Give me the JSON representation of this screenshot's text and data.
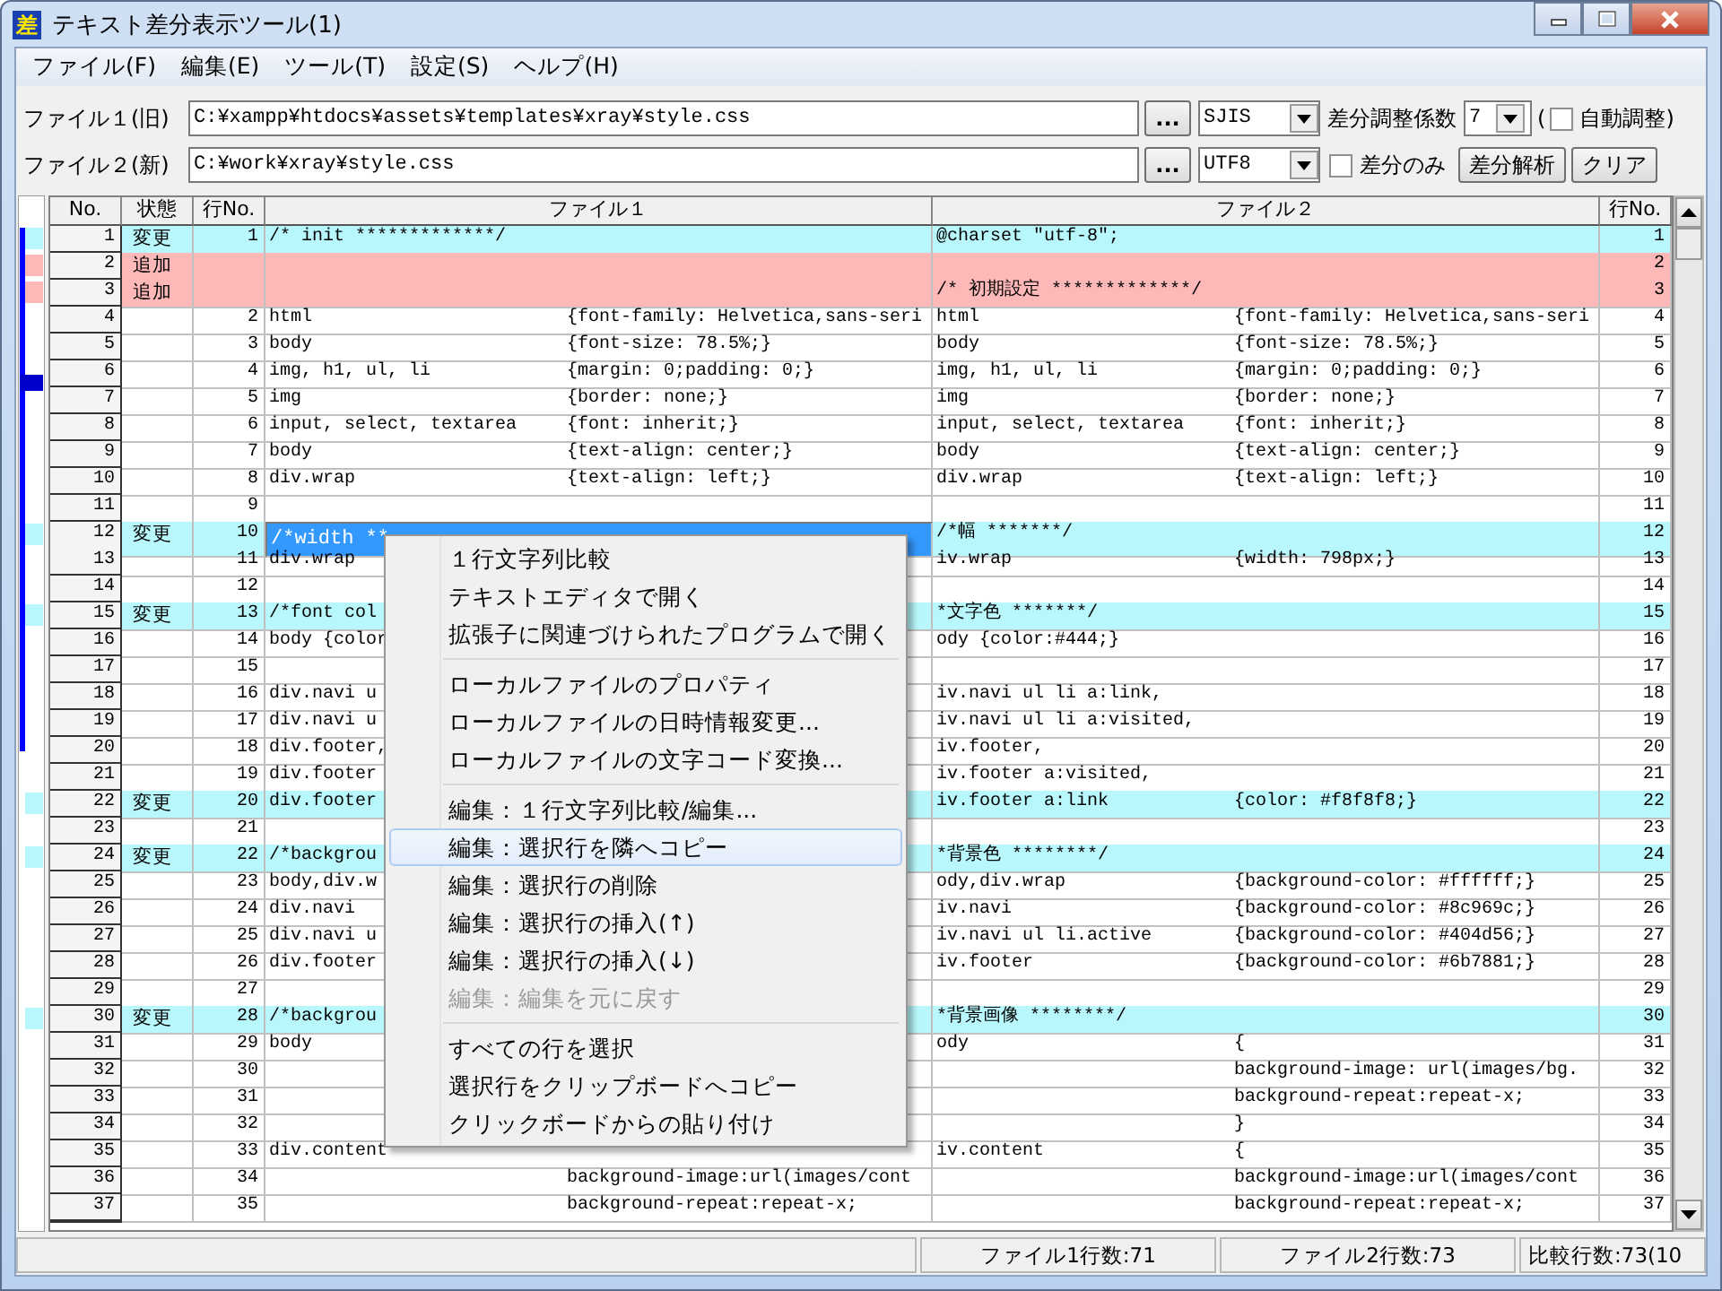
{
  "window": {
    "app_icon": "差",
    "title": "テキスト差分表示ツール(1)"
  },
  "menu_bar": [
    "ファイル(F)",
    "編集(E)",
    "ツール(T)",
    "設定(S)",
    "ヘルプ(H)"
  ],
  "file1": {
    "label": "ファイル１(旧)",
    "path": "C:¥xampp¥htdocs¥assets¥templates¥xray¥style.css",
    "browse": "...",
    "encoding": "SJIS"
  },
  "tuning": {
    "label": "差分調整係数",
    "value": "7",
    "open_paren": "(",
    "auto_label": "自動調整)",
    "auto_checked": false
  },
  "file2": {
    "label": "ファイル２(新)",
    "path": "C:¥work¥xray¥style.css",
    "browse": "...",
    "encoding": "UTF8"
  },
  "diff_only": {
    "label": "差分のみ",
    "checked": false
  },
  "buttons": [
    "差分解析",
    "クリア"
  ],
  "table": {
    "columns": [
      "No.",
      "状態",
      "行No.",
      "ファイル１",
      "ファイル２",
      "行No."
    ],
    "rows": [
      {
        "no": "1",
        "state": "変更",
        "kind": "changed",
        "line1": "1",
        "file1_a": "/* init *************/",
        "file2_a": "@charset \"utf-8\";",
        "line2": "1",
        "selected": false
      },
      {
        "no": "2",
        "state": "追加",
        "kind": "added",
        "line2": "2",
        "selected": false
      },
      {
        "no": "3",
        "state": "追加",
        "kind": "added",
        "file2_a": "/* 初期設定 *************/",
        "line2": "3",
        "selected": false
      },
      {
        "no": "4",
        "kind": "same",
        "line1": "2",
        "file1_a": "html",
        "file1_b": "{font-family: Helvetica,sans-seri",
        "file2_a": "html",
        "file2_b": "{font-family: Helvetica,sans-seri",
        "line2": "4",
        "selected": false
      },
      {
        "no": "5",
        "kind": "same",
        "line1": "3",
        "file1_a": "body",
        "file1_b": "{font-size: 78.5%;}",
        "file2_a": "body",
        "file2_b": "{font-size: 78.5%;}",
        "line2": "5",
        "selected": false
      },
      {
        "no": "6",
        "kind": "same",
        "line1": "4",
        "file1_a": "img, h1, ul, li",
        "file1_b": "{margin: 0;padding: 0;}",
        "file2_a": "img, h1, ul, li",
        "file2_b": "{margin: 0;padding: 0;}",
        "line2": "6",
        "selected": false
      },
      {
        "no": "7",
        "kind": "same",
        "line1": "5",
        "file1_a": "img",
        "file1_b": "{border: none;}",
        "file2_a": "img",
        "file2_b": "{border: none;}",
        "line2": "7",
        "selected": false
      },
      {
        "no": "8",
        "kind": "same",
        "line1": "6",
        "file1_a": "input, select, textarea",
        "file1_b": "{font: inherit;}",
        "file2_a": "input, select, textarea",
        "file2_b": "{font: inherit;}",
        "line2": "8",
        "selected": false
      },
      {
        "no": "9",
        "kind": "same",
        "line1": "7",
        "file1_a": "body",
        "file1_b": "{text-align: center;}",
        "file2_a": "body",
        "file2_b": "{text-align: center;}",
        "line2": "9",
        "selected": false
      },
      {
        "no": "10",
        "kind": "same",
        "line1": "8",
        "file1_a": "div.wrap",
        "file1_b": "{text-align: left;}",
        "file2_a": "div.wrap",
        "file2_b": "{text-align: left;}",
        "line2": "10",
        "selected": false
      },
      {
        "no": "11",
        "kind": "same",
        "line1": "9",
        "line2": "11",
        "selected": false
      },
      {
        "no": "12",
        "state": "変更",
        "kind": "changed",
        "line1": "10",
        "file1_a": "/*width **",
        "file2_a": "/*幅 *******/",
        "line2": "12",
        "selected": true
      },
      {
        "no": "13",
        "kind": "same",
        "line1": "11",
        "file1_a": "div.wrap",
        "file2_a": "iv.wrap",
        "file2_b": "{width: 798px;}",
        "line2": "13",
        "selected": false
      },
      {
        "no": "14",
        "kind": "same",
        "line1": "12",
        "line2": "14",
        "selected": false
      },
      {
        "no": "15",
        "state": "変更",
        "kind": "changed",
        "line1": "13",
        "file1_a": "/*font col",
        "file2_a": "*文字色 *******/",
        "line2": "15",
        "selected": false
      },
      {
        "no": "16",
        "kind": "same",
        "line1": "14",
        "file1_a": "body {color",
        "file2_a": "ody {color:#444;}",
        "line2": "16",
        "selected": false
      },
      {
        "no": "17",
        "kind": "same",
        "line1": "15",
        "line2": "17",
        "selected": false
      },
      {
        "no": "18",
        "kind": "same",
        "line1": "16",
        "file1_a": "div.navi u",
        "file2_a": "iv.navi ul li a:link,",
        "line2": "18",
        "selected": false
      },
      {
        "no": "19",
        "kind": "same",
        "line1": "17",
        "file1_a": "div.navi u",
        "file2_a": "iv.navi ul li a:visited,",
        "line2": "19",
        "selected": false
      },
      {
        "no": "20",
        "kind": "same",
        "line1": "18",
        "file1_a": "div.footer,",
        "file2_a": "iv.footer,",
        "line2": "20",
        "selected": false
      },
      {
        "no": "21",
        "kind": "same",
        "line1": "19",
        "file1_a": "div.footer",
        "file2_a": "iv.footer a:visited,",
        "line2": "21",
        "selected": false
      },
      {
        "no": "22",
        "state": "変更",
        "kind": "changed",
        "line1": "20",
        "file1_a": "div.footer",
        "file2_a": "iv.footer a:link",
        "file2_b": "{color: #f8f8f8;}",
        "line2": "22",
        "selected": false
      },
      {
        "no": "23",
        "kind": "same",
        "line1": "21",
        "line2": "23",
        "selected": false
      },
      {
        "no": "24",
        "state": "変更",
        "kind": "changed",
        "line1": "22",
        "file1_a": "/*backgrou",
        "file2_a": "*背景色 ********/",
        "line2": "24",
        "selected": false
      },
      {
        "no": "25",
        "kind": "same",
        "line1": "23",
        "file1_a": "body,div.w",
        "file2_a": "ody,div.wrap",
        "file2_b": "{background-color: #ffffff;}",
        "line2": "25",
        "selected": false
      },
      {
        "no": "26",
        "kind": "same",
        "line1": "24",
        "file1_a": "div.navi",
        "file2_a": "iv.navi",
        "file2_b": "{background-color: #8c969c;}",
        "line2": "26",
        "selected": false
      },
      {
        "no": "27",
        "kind": "same",
        "line1": "25",
        "file1_a": "div.navi u",
        "file2_a": "iv.navi ul li.active",
        "file2_b": "{background-color: #404d56;}",
        "line2": "27",
        "selected": false
      },
      {
        "no": "28",
        "kind": "same",
        "line1": "26",
        "file1_a": "div.footer",
        "file2_a": "iv.footer",
        "file2_b": "{background-color: #6b7881;}",
        "line2": "28",
        "selected": false
      },
      {
        "no": "29",
        "kind": "same",
        "line1": "27",
        "line2": "29",
        "selected": false
      },
      {
        "no": "30",
        "state": "変更",
        "kind": "changed",
        "line1": "28",
        "file1_a": "/*backgrou",
        "file2_a": "*背景画像 ********/",
        "line2": "30",
        "selected": false
      },
      {
        "no": "31",
        "kind": "same",
        "line1": "29",
        "file1_a": "body",
        "file2_a": "ody",
        "file2_b": "{",
        "line2": "31",
        "selected": false
      },
      {
        "no": "32",
        "kind": "same",
        "line1": "30",
        "file2_b": "background-image: url(images/bg.",
        "line2": "32",
        "selected": false
      },
      {
        "no": "33",
        "kind": "same",
        "line1": "31",
        "file2_b": "background-repeat:repeat-x;",
        "line2": "33",
        "selected": false
      },
      {
        "no": "34",
        "kind": "same",
        "line1": "32",
        "file2_b": "}",
        "line2": "34",
        "selected": false
      },
      {
        "no": "35",
        "kind": "same",
        "line1": "33",
        "file1_a": "div.content",
        "file2_a": "iv.content",
        "file2_b": "{",
        "line2": "35",
        "selected": false
      },
      {
        "no": "36",
        "kind": "same",
        "line1": "34",
        "file1_b": "background-image:url(images/cont",
        "file2_b": "background-image:url(images/cont",
        "line2": "36",
        "selected": false
      },
      {
        "no": "37",
        "kind": "same",
        "line1": "35",
        "file1_b": "background-repeat:repeat-x;",
        "file2_b": "background-repeat:repeat-x;",
        "line2": "37",
        "selected": false
      }
    ]
  },
  "context_menu": [
    {
      "kind": "item",
      "label": "１行文字列比較",
      "highlighted": false,
      "disabled": false
    },
    {
      "kind": "item",
      "label": "テキストエディタで開く",
      "highlighted": false,
      "disabled": false
    },
    {
      "kind": "item",
      "label": "拡張子に関連づけられたプログラムで開く",
      "highlighted": false,
      "disabled": false
    },
    {
      "kind": "separator"
    },
    {
      "kind": "item",
      "label": "ローカルファイルのプロパティ",
      "highlighted": false,
      "disabled": false
    },
    {
      "kind": "item",
      "label": "ローカルファイルの日時情報変更...",
      "highlighted": false,
      "disabled": false
    },
    {
      "kind": "item",
      "label": "ローカルファイルの文字コード変換...",
      "highlighted": false,
      "disabled": false
    },
    {
      "kind": "separator"
    },
    {
      "kind": "item",
      "label": "編集：１行文字列比較/編集...",
      "highlighted": false,
      "disabled": false
    },
    {
      "kind": "item",
      "label": "編集：選択行を隣へコピー",
      "highlighted": true,
      "disabled": false
    },
    {
      "kind": "item",
      "label": "編集：選択行の削除",
      "highlighted": false,
      "disabled": false
    },
    {
      "kind": "item",
      "label": "編集：選択行の挿入(↑)",
      "highlighted": false,
      "disabled": false
    },
    {
      "kind": "item",
      "label": "編集：選択行の挿入(↓)",
      "highlighted": false,
      "disabled": false
    },
    {
      "kind": "item",
      "label": "編集：編集を元に戻す",
      "highlighted": false,
      "disabled": true
    },
    {
      "kind": "separator"
    },
    {
      "kind": "item",
      "label": "すべての行を選択",
      "highlighted": false,
      "disabled": false
    },
    {
      "kind": "item",
      "label": "選択行をクリップボードへコピー",
      "highlighted": false,
      "disabled": false
    },
    {
      "kind": "item",
      "label": "クリックボードからの貼り付け",
      "highlighted": false,
      "disabled": false
    }
  ],
  "status_bar": [
    "ファイル1行数:71",
    "ファイル2行数:73",
    "比較行数:73(10"
  ]
}
